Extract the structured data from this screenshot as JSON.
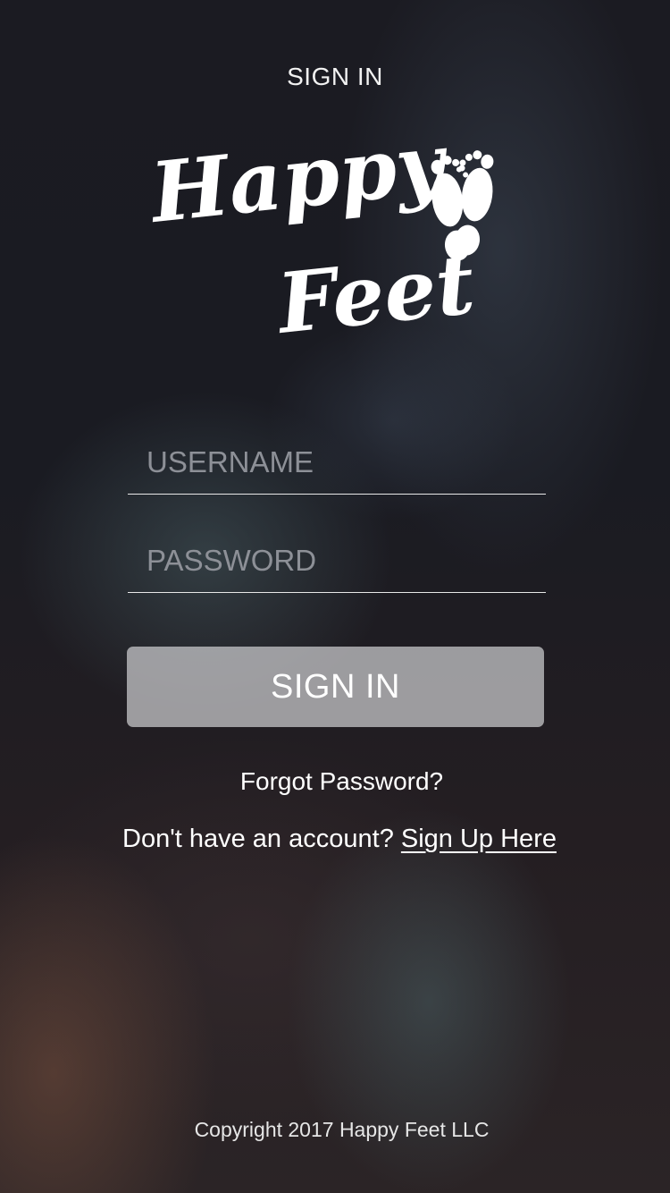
{
  "header": {
    "title": "SIGN IN"
  },
  "logo": {
    "line1": "Happy",
    "line2": "Feet",
    "icon": "footprints-icon"
  },
  "form": {
    "username_placeholder": "USERNAME",
    "username_value": "",
    "password_placeholder": "PASSWORD",
    "password_value": "",
    "submit_label": "SIGN IN"
  },
  "links": {
    "forgot_password": "Forgot Password?",
    "signup_prompt": "Don't have an account?",
    "signup_link": "Sign Up Here"
  },
  "footer": {
    "copyright": "Copyright 2017 Happy Feet LLC"
  },
  "colors": {
    "text": "#ffffff",
    "placeholder": "#8d9097",
    "button_bg": "#cdcdd0"
  }
}
